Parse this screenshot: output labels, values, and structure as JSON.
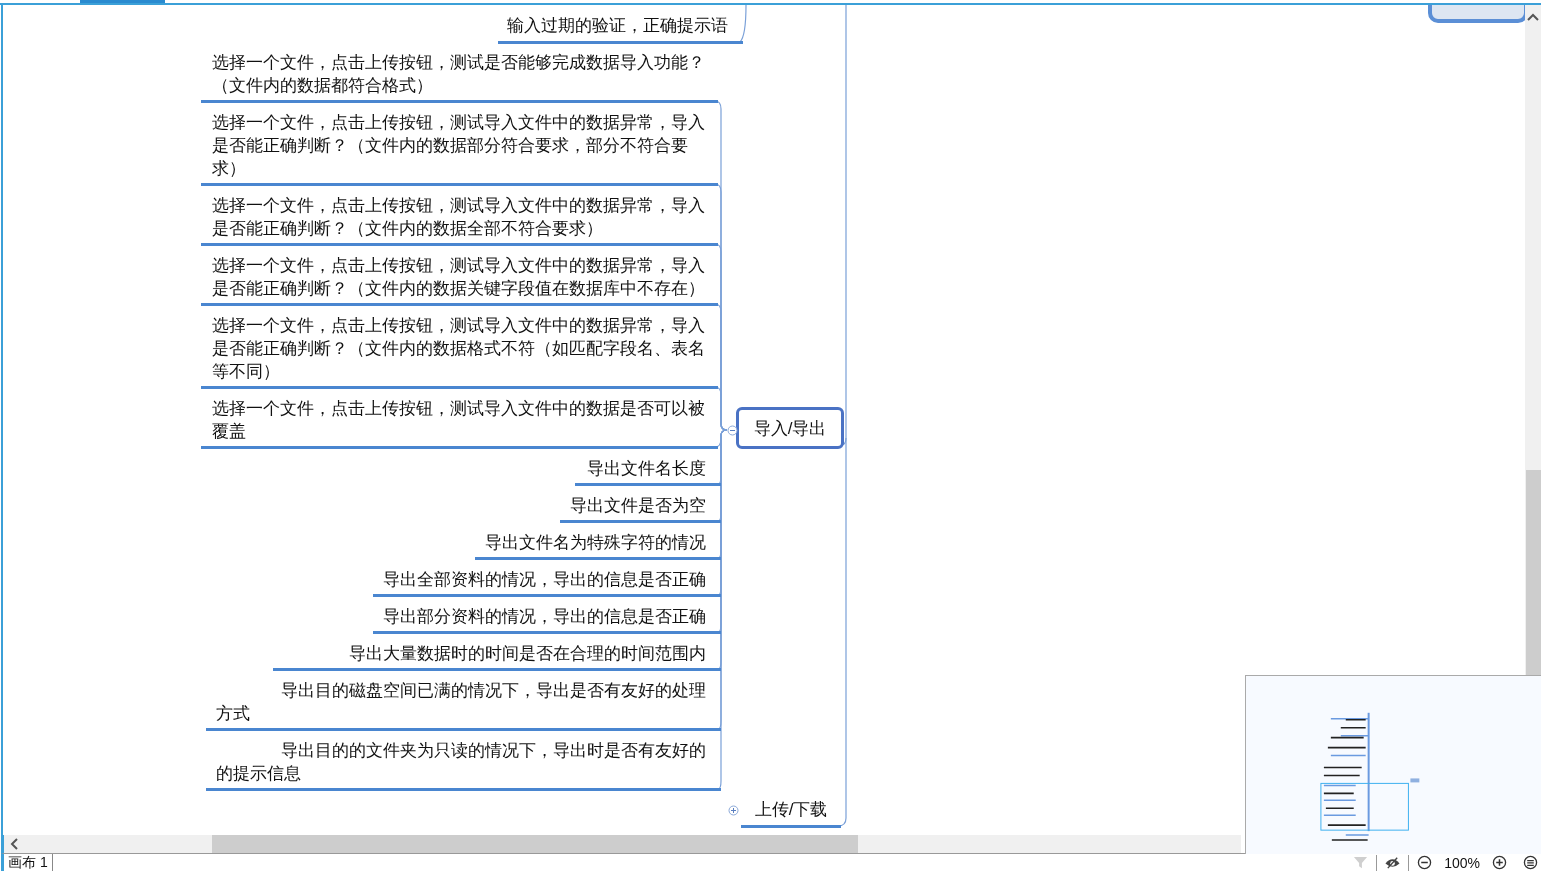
{
  "map": {
    "topics": [
      {
        "lines": [
          "输入过期的验证，正确提示语"
        ]
      },
      {
        "lines": [
          "选择一个文件，点击上传按钮，测试是否能够完成数据导入功能？",
          "（文件内的数据都符合格式）"
        ]
      },
      {
        "lines": [
          "选择一个文件，点击上传按钮，测试导入文件中的数据异常，导入",
          "是否能正确判断？（文件内的数据部分符合要求，部分不符合要",
          "求）"
        ]
      },
      {
        "lines": [
          "选择一个文件，点击上传按钮，测试导入文件中的数据异常，导入",
          "是否能正确判断？（文件内的数据全部不符合要求）"
        ]
      },
      {
        "lines": [
          "选择一个文件，点击上传按钮，测试导入文件中的数据异常，导入",
          "是否能正确判断？（文件内的数据关键字段值在数据库中不存在）"
        ]
      },
      {
        "lines": [
          "选择一个文件，点击上传按钮，测试导入文件中的数据异常，导入",
          "是否能正确判断？（文件内的数据格式不符（如匹配字段名、表名",
          "等不同）"
        ]
      },
      {
        "lines": [
          "选择一个文件，点击上传按钮，测试导入文件中的数据是否可以被",
          "覆盖"
        ]
      },
      {
        "lines": [
          "导出文件名长度"
        ]
      },
      {
        "lines": [
          "导出文件是否为空"
        ]
      },
      {
        "lines": [
          "导出文件名为特殊字符的情况"
        ]
      },
      {
        "lines": [
          "导出全部资料的情况，导出的信息是否正确"
        ]
      },
      {
        "lines": [
          "导出部分资料的情况，导出的信息是否正确"
        ]
      },
      {
        "lines": [
          "导出大量数据时的时间是否在合理的时间范围内"
        ]
      },
      {
        "lines": [
          "导出目的磁盘空间已满的情况下，导出是否有友好的处理",
          "方式"
        ]
      },
      {
        "lines": [
          "导出目的的文件夹为只读的情况下，导出时是否有友好的",
          "的提示信息"
        ]
      }
    ],
    "center": {
      "label": "导入/导出",
      "expanded": true
    },
    "sibling": {
      "label": "上传/下载",
      "expanded": false
    }
  },
  "status_bar": {
    "sheet_tab": "画布 1",
    "zoom": "100%"
  }
}
